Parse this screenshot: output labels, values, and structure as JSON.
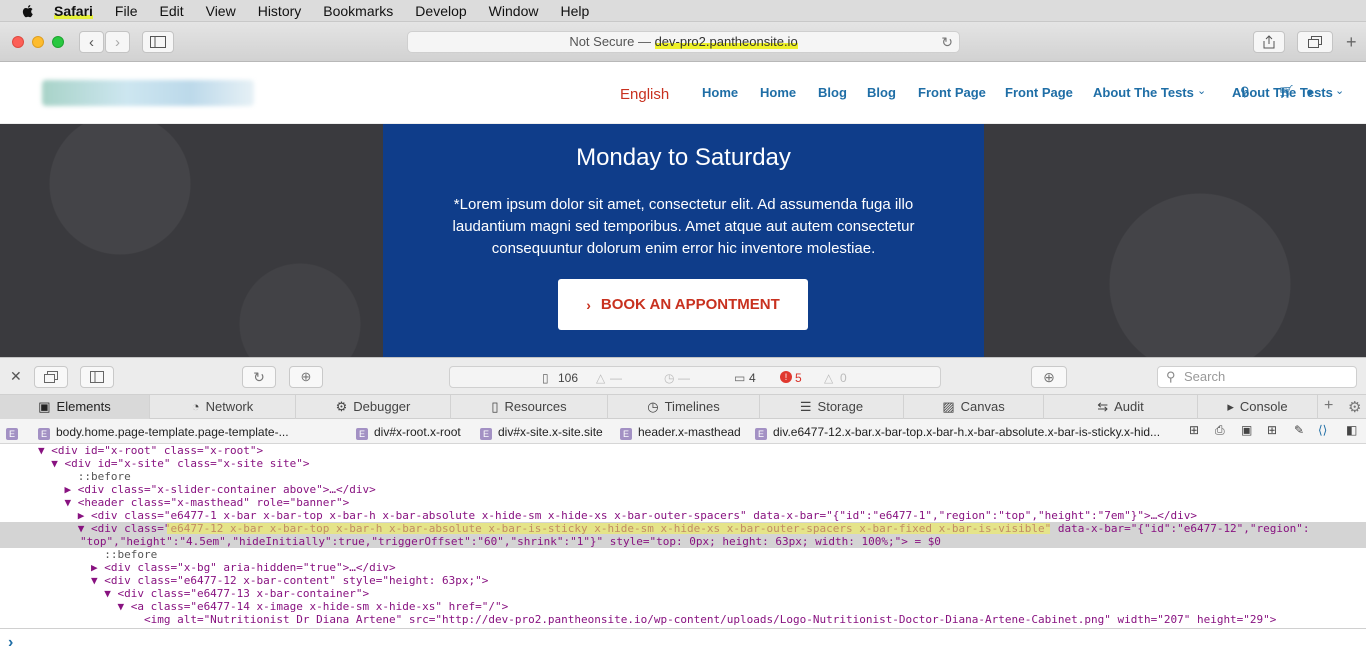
{
  "menubar": {
    "app": "Safari",
    "items": [
      "File",
      "Edit",
      "View",
      "History",
      "Bookmarks",
      "Develop",
      "Window",
      "Help"
    ]
  },
  "toolbar": {
    "address_prefix": "Not Secure — ",
    "address_host": "dev-pro2.pantheonsite.io"
  },
  "site": {
    "lang": "English",
    "nav": [
      "Home",
      "Home",
      "Blog",
      "Blog",
      "Front Page",
      "Front Page",
      "About The Tests",
      "About The Tests"
    ],
    "hero": {
      "heading": "Monday to Saturday",
      "text": "*Lorem ipsum dolor sit amet, consectetur elit. Ad assumenda fuga illo laudantium magni sed temporibus. Amet atque aut autem consectetur consequuntur dolorum enim error hic inventore molestiae.",
      "cta": "BOOK AN APPONTMENT"
    }
  },
  "devtools": {
    "status": {
      "resources": "106",
      "dash1": "—",
      "dash2": "—",
      "messages": "4",
      "errors": "5",
      "warnings": "0"
    },
    "search_placeholder": "Search",
    "tabs": [
      "Elements",
      "Network",
      "Debugger",
      "Resources",
      "Timelines",
      "Storage",
      "Canvas",
      "Audit",
      "Console"
    ],
    "crumbs": [
      "body.home.page-template.page-template-...",
      "div#x-root.x-root",
      "div#x-site.x-site.site",
      "header.x-masthead",
      "div.e6477-12.x-bar.x-bar-top.x-bar-h.x-bar-absolute.x-bar-is-sticky.x-hid..."
    ],
    "dom": [
      "▼ <div id=\"x-root\" class=\"x-root\">",
      "  ▼ <div id=\"x-site\" class=\"x-site site\">",
      "      ::before",
      "    ▶ <div class=\"x-slider-container above\">…</div>",
      "    ▼ <header class=\"x-masthead\" role=\"banner\">",
      "      ▶ <div class=\"e6477-1 x-bar x-bar-top x-bar-h x-bar-absolute x-hide-sm x-hide-xs x-bar-outer-spacers\" data-x-bar=\"{\"id\":\"e6477-1\",\"region\":\"top\",\"height\":\"7em\"}\">…</div>",
      "      ▼ <div class=\"e6477-12 x-bar x-bar-top x-bar-h x-bar-absolute x-bar-is-sticky x-hide-sm x-hide-xs x-bar-outer-spacers x-bar-fixed x-bar-is-visible\" data-x-bar=\"{\"id\":\"e6477-12\",\"region\":",
      "\"top\",\"height\":\"4.5em\",\"hideInitially\":true,\"triggerOffset\":\"60\",\"shrink\":\"1\"}\" style=\"top: 0px; height: 63px; width: 100%;\"> = $0",
      "          ::before",
      "        ▶ <div class=\"x-bg\" aria-hidden=\"true\">…</div>",
      "        ▼ <div class=\"e6477-12 x-bar-content\" style=\"height: 63px;\">",
      "          ▼ <div class=\"e6477-13 x-bar-container\">",
      "            ▼ <a class=\"e6477-14 x-image x-hide-sm x-hide-xs\" href=\"/\">",
      "                <img alt=\"Nutritionist Dr Diana Artene\" src=\"http://dev-pro2.pantheonsite.io/wp-content/uploads/Logo-Nutritionist-Doctor-Diana-Artene-Cabinet.png\" width=\"207\" height=\"29\">"
    ],
    "selected_class_highlight": "e6477-12 x-bar x-bar-top x-bar-h x-bar-absolute x-bar-is-sticky x-hide-sm x-hide-xs x-bar-outer-spacers x-bar-fixed x-bar-is-visible",
    "console_prompt": "›"
  },
  "colors": {
    "accent_red": "#c8311f",
    "nav_blue": "#1f6ea6",
    "hero_blue": "#0f3d8a",
    "highlight": "#f3f04a"
  }
}
